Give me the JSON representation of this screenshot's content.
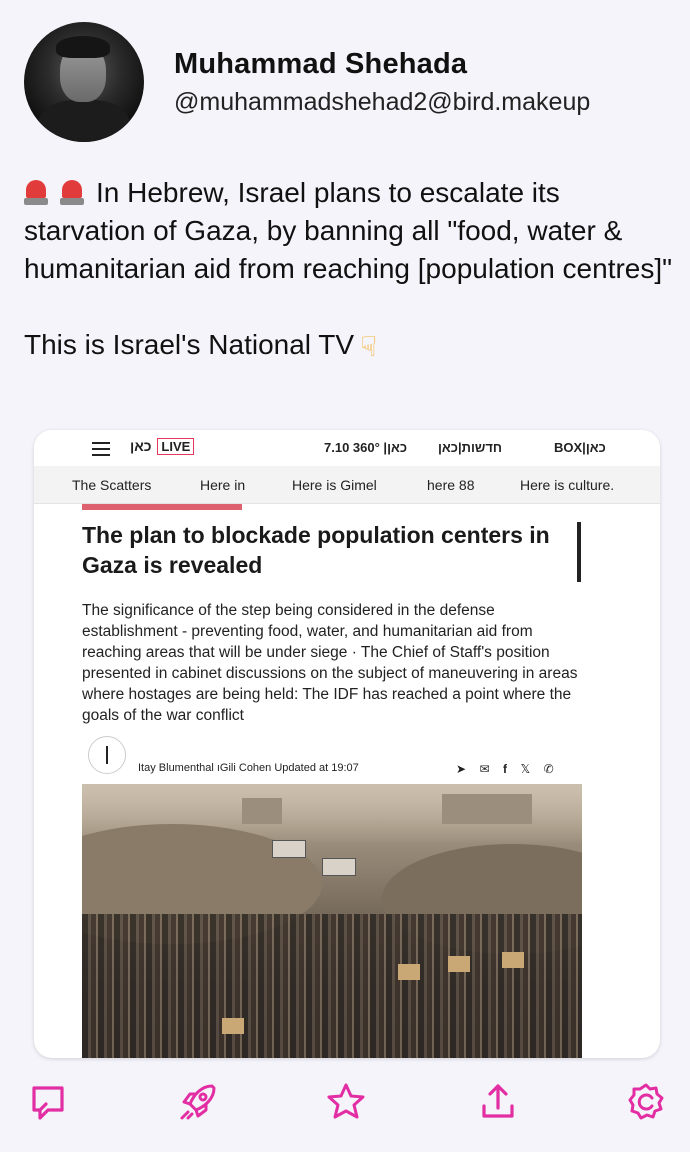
{
  "author": {
    "display_name": "Muhammad Shehada",
    "handle": "@muhammadshehad2@bird.makeup"
  },
  "post": {
    "line1": "In Hebrew, Israel plans to escalate its starvation of Gaza, by banning all \"food, water & humanitarian aid from reaching [population centres]\"",
    "line2": "This is Israel's National TV",
    "emoji_lead": [
      "police-car-light",
      "police-car-light"
    ],
    "emoji_trail": "backhand-index-pointing-down"
  },
  "embed": {
    "topbar": {
      "logo": "‏כאן",
      "live": "LIVE",
      "link1": "7.10 360° |כאן",
      "link2": "חדשות|כאן",
      "link3": "BOX|כאן"
    },
    "nav": [
      "The Scatters",
      "Here in",
      "Here is Gimel",
      "here 88",
      "Here is culture."
    ],
    "headline": "The plan to blockade population centers in Gaza is revealed",
    "summary": "The significance of the step being considered in the defense establishment - preventing food, water, and humanitarian aid from reaching areas that will be under siege · The Chief of Staff's position presented in cabinet discussions on the subject of maneuvering in areas where hostages are being held: The IDF has reached a point where the goals of the war conflict",
    "authors": "Itay Blumenthal ıGili Cohen",
    "updated": "Updated at 19:07",
    "share_icons": [
      "telegram-icon",
      "mail-icon",
      "facebook-icon",
      "x-icon",
      "whatsapp-icon"
    ]
  },
  "actions": [
    "reply-icon",
    "boost-icon",
    "favourite-icon",
    "share-icon",
    "more-icon"
  ],
  "colors": {
    "accent": "#e22da3",
    "background": "#f5f4fb",
    "live_border": "#e23b5a"
  }
}
